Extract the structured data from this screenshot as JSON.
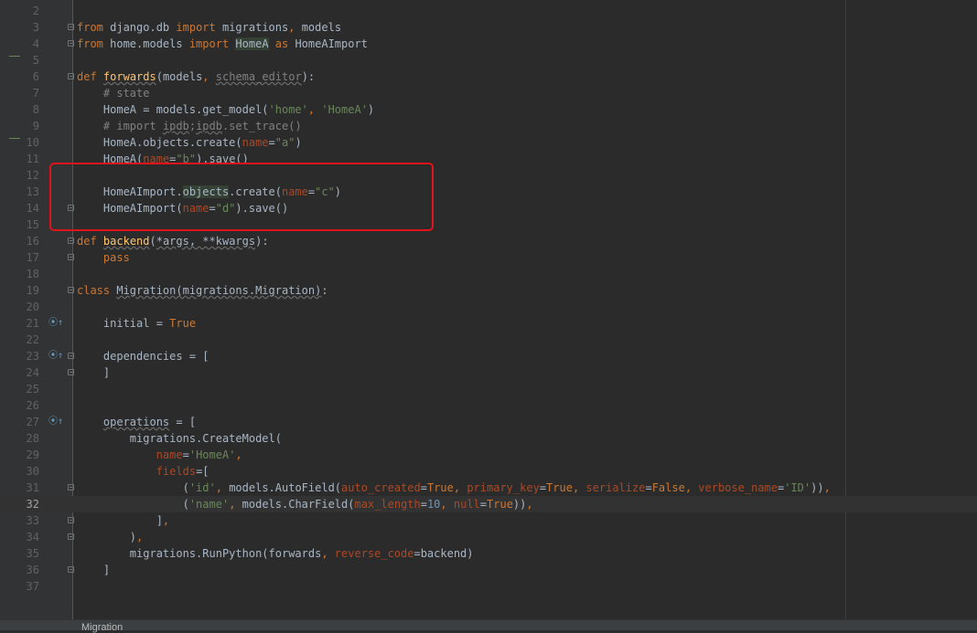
{
  "editor": {
    "lines": [
      {
        "n": "2",
        "html": ""
      },
      {
        "n": "3",
        "html": "<span class=\"kw\">from</span> django.db <span class=\"kw\">import</span> migrations<span class=\"kw\">,</span> models"
      },
      {
        "n": "4",
        "html": "<span class=\"kw\">from</span> home.models <span class=\"kw\">import</span> <span class=\"hl\">HomeA</span> <span class=\"kw\">as</span> HomeAImport"
      },
      {
        "n": "5",
        "html": ""
      },
      {
        "n": "6",
        "html": "<span class=\"kw\">def</span> <span class=\"fn ul\">forwards</span>(models<span class=\"kw\">,</span> <span class=\"cm ul\">schema_editor</span>):"
      },
      {
        "n": "7",
        "html": "    <span class=\"cm\"># state</span>"
      },
      {
        "n": "8",
        "html": "    HomeA = models.get_model(<span class=\"str\">'home'</span><span class=\"kw\">,</span> <span class=\"str\">'HomeA'</span>)"
      },
      {
        "n": "9",
        "html": "    <span class=\"cm\"># import <span class=\"ul\">ipdb</span>;<span class=\"ul\">ipdb</span>.set_trace()</span>"
      },
      {
        "n": "10",
        "html": "    HomeA.objects.create(<span class=\"param\">name</span>=<span class=\"str\">\"a\"</span>)"
      },
      {
        "n": "11",
        "html": "    HomeA(<span class=\"param\">name</span>=<span class=\"str\">\"b\"</span>).save()"
      },
      {
        "n": "12",
        "html": ""
      },
      {
        "n": "13",
        "html": "    HomeAImport.<span class=\"hl\">objects</span>.create(<span class=\"param\">name</span>=<span class=\"str\">\"c\"</span>)"
      },
      {
        "n": "14",
        "html": "    HomeAImport(<span class=\"param\">name</span>=<span class=\"str\">\"d\"</span>).save()"
      },
      {
        "n": "15",
        "html": ""
      },
      {
        "n": "16",
        "html": "<span class=\"kw\">def</span> <span class=\"fn ul\">backend</span>(<span class=\"ul\">*args, **kwargs</span>):"
      },
      {
        "n": "17",
        "html": "    <span class=\"kw\">pass</span>"
      },
      {
        "n": "18",
        "html": ""
      },
      {
        "n": "19",
        "html": "<span class=\"kw\">class</span> <span class=\"ul\">Migration(migrations.Migration)</span>:"
      },
      {
        "n": "20",
        "html": ""
      },
      {
        "n": "21",
        "html": "    initial = <span class=\"kw\">True</span>"
      },
      {
        "n": "22",
        "html": ""
      },
      {
        "n": "23",
        "html": "    dependencies = ["
      },
      {
        "n": "24",
        "html": "    ]"
      },
      {
        "n": "25",
        "html": ""
      },
      {
        "n": "26",
        "html": ""
      },
      {
        "n": "27",
        "html": "    <span class=\"ul\">operations</span> = ["
      },
      {
        "n": "28",
        "html": "        migrations.CreateModel("
      },
      {
        "n": "29",
        "html": "            <span class=\"param\">name</span>=<span class=\"str\">'HomeA'</span><span class=\"kw\">,</span>"
      },
      {
        "n": "30",
        "html": "            <span class=\"param\">fields</span>=["
      },
      {
        "n": "31",
        "html": "                (<span class=\"str\">'id'</span><span class=\"kw\">,</span> models.AutoField(<span class=\"param\">auto_created</span>=<span class=\"kw\">True</span><span class=\"kw\">,</span> <span class=\"param\">primary_key</span>=<span class=\"kw\">True</span><span class=\"kw\">,</span> <span class=\"param\">serialize</span>=<span class=\"kw\">False</span><span class=\"kw\">,</span> <span class=\"param\">verbose_name</span>=<span class=\"str\">'ID'</span>))<span class=\"kw\">,</span>"
      },
      {
        "n": "32",
        "html": "                (<span class=\"str\">'name'</span><span class=\"kw\">,</span> models.CharField(<span class=\"param\">max_length</span>=<span class=\"nm\">10</span><span class=\"kw\">,</span> <span class=\"param\">null</span>=<span class=\"kw\">True</span>))<span class=\"kw\">,</span>"
      },
      {
        "n": "33",
        "html": "            ]<span class=\"kw\">,</span>"
      },
      {
        "n": "34",
        "html": "        )<span class=\"kw\">,</span>"
      },
      {
        "n": "35",
        "html": "        migrations.RunPython(forwards<span class=\"kw\">,</span> <span class=\"param\">reverse_code</span>=backend)"
      },
      {
        "n": "36",
        "html": "    ]"
      },
      {
        "n": "37",
        "html": ""
      }
    ],
    "current_line": "32",
    "override_markers": [
      "21",
      "23",
      "27"
    ],
    "fold_markers": [
      "3",
      "4",
      "6",
      "14",
      "16",
      "17",
      "19",
      "23",
      "24",
      "31",
      "33",
      "34",
      "36"
    ],
    "vcs_changed_lines": [
      "5",
      "10"
    ]
  },
  "status": {
    "breadcrumb": "Migration"
  }
}
